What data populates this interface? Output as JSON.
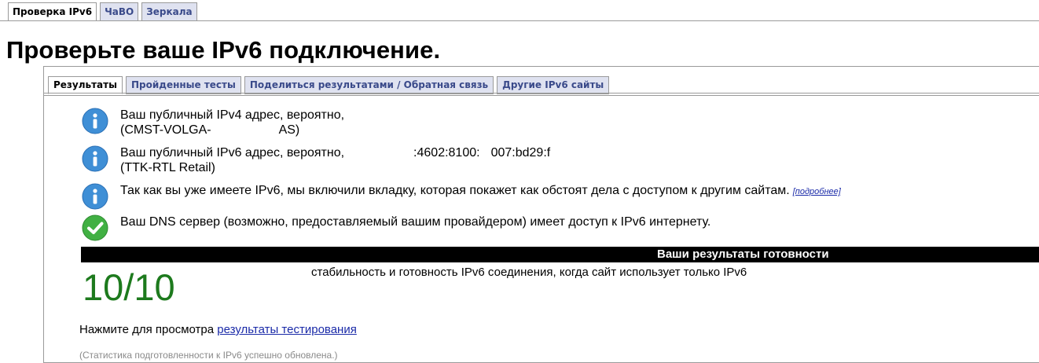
{
  "top_tabs": [
    "Проверка IPv6",
    "ЧаВО",
    "Зеркала"
  ],
  "page_title": "Проверьте ваше IPv6 подключение.",
  "inner_tabs": [
    "Результаты",
    "Пройденные тесты",
    "Поделиться результатами / Обратная связь",
    "Другие IPv6 сайты"
  ],
  "messages": [
    {
      "icon": "info-icon",
      "line1": "Ваш публичный IPv4 адрес, вероятно,",
      "line2a": "(CMST-VOLGA-",
      "line2b": "AS)"
    },
    {
      "icon": "info-icon",
      "line1a": "Ваш публичный IPv6 адрес, вероятно,",
      "line1b": ":4602:8100:",
      "line1c": "007:bd29:f",
      "line2": "(TTK-RTL Retail)"
    },
    {
      "icon": "info-icon",
      "line1": "Так как вы уже имеете IPv6, мы включили вкладку, которая покажет как обстоят дела с доступом к другим сайтам.",
      "more": "[подробнее]"
    },
    {
      "icon": "check-icon",
      "line1": "Ваш DNS сервер (возможно, предоставляемый вашим провайдером) имеет доступ к IPv6 интернету."
    }
  ],
  "readiness": {
    "title": "Ваши результаты готовности",
    "score": "10/10",
    "description": "стабильность и готовность IPv6 соединения, когда сайт использует только IPv6"
  },
  "click_prefix": "Нажмите для просмотра",
  "results_link": "результаты тестирования",
  "stat_note": "(Статистика подготовленности к IPv6 успешно обновлена.)",
  "colors": {
    "info": "#3f8fd6",
    "check": "#41b043",
    "score": "#1d7a1d",
    "tab_bg": "#dfe2f0",
    "tab_text": "#3a4a8a",
    "link": "#1a2aa8"
  }
}
